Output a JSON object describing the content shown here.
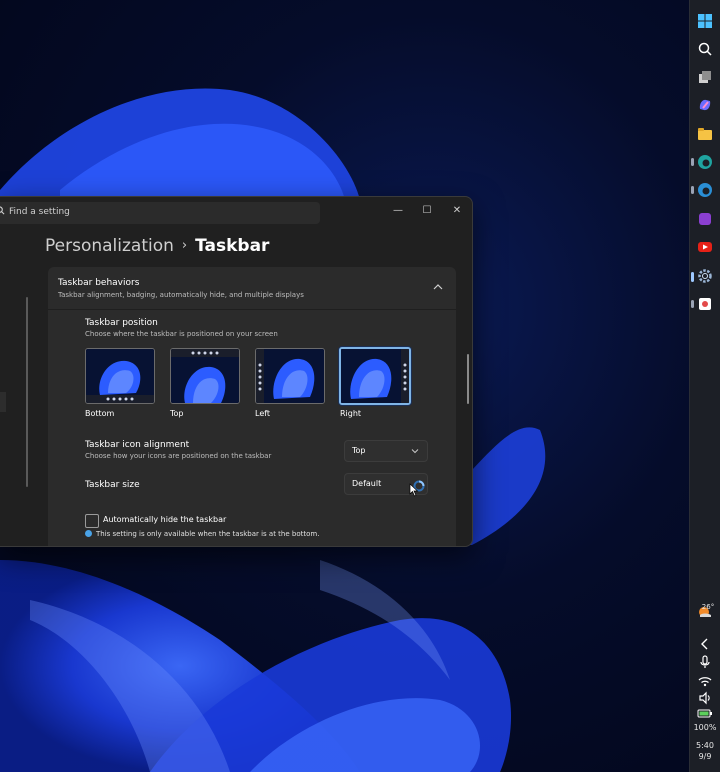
{
  "window": {
    "search_placeholder": "Find a setting",
    "minimize_glyph": "—",
    "maximize_glyph": "☐",
    "close_glyph": "✕"
  },
  "breadcrumb": {
    "parent": "Personalization",
    "separator": "›",
    "current": "Taskbar"
  },
  "behaviors": {
    "title": "Taskbar behaviors",
    "subtitle": "Taskbar alignment, badging, automatically hide, and multiple displays"
  },
  "position": {
    "label": "Taskbar position",
    "description": "Choose where the taskbar is positioned on your screen",
    "options": [
      {
        "label": "Bottom",
        "selected": false
      },
      {
        "label": "Top",
        "selected": false
      },
      {
        "label": "Left",
        "selected": false
      },
      {
        "label": "Right",
        "selected": true
      }
    ]
  },
  "alignment": {
    "label": "Taskbar icon alignment",
    "description": "Choose how your icons are positioned on the taskbar",
    "value": "Top"
  },
  "size": {
    "label": "Taskbar size",
    "value": "Default"
  },
  "autohide": {
    "label": "Automatically hide the taskbar",
    "checked": false,
    "note": "This setting is only available when the taskbar is at the bottom."
  },
  "taskbar": {
    "icons": [
      "start-icon",
      "search-icon",
      "task-view-icon",
      "copilot-icon",
      "file-explorer-icon",
      "edge-icon",
      "edge-beta-icon",
      "app-icon",
      "youtube-icon",
      "settings-icon",
      "snipping-tool-icon"
    ],
    "weather_temp": "26°",
    "battery_percent": "100%",
    "time": "5:40",
    "date": "9/9"
  },
  "colors": {
    "accent": "#7fb4e6",
    "info": "#4aa3e8",
    "window_bg": "#202020",
    "panel_bg": "#2b2b2b"
  }
}
